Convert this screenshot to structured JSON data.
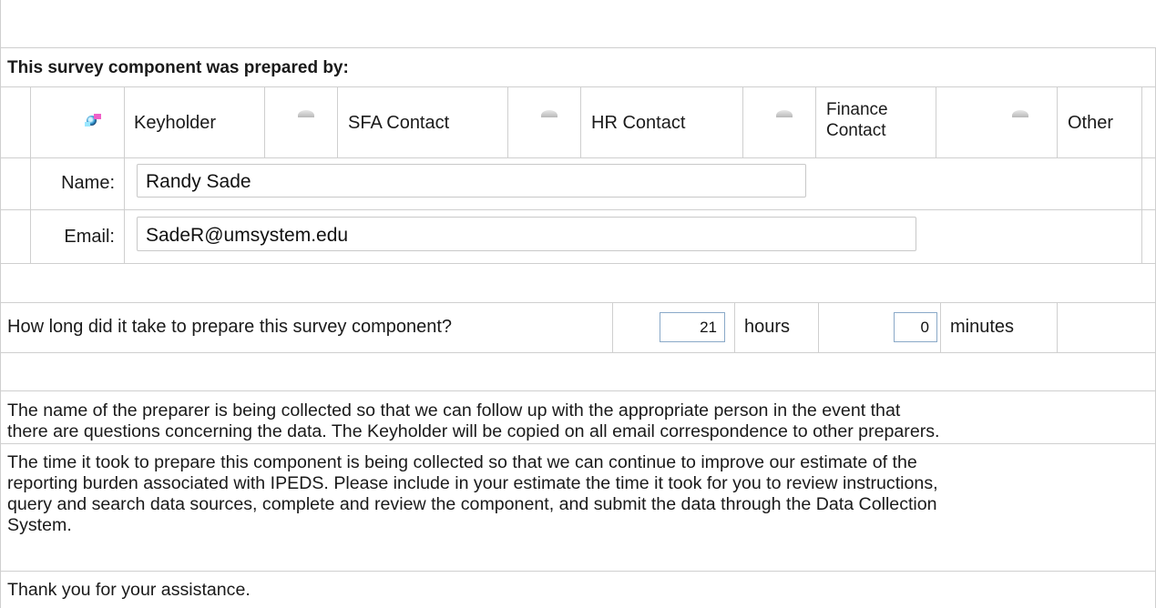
{
  "section": {
    "heading": "This survey component was prepared by:"
  },
  "preparer_options": [
    {
      "label": "Keyholder",
      "selected": true
    },
    {
      "label": "SFA Contact",
      "selected": false
    },
    {
      "label": "HR Contact",
      "selected": false
    },
    {
      "label": "Finance Contact",
      "line1": "Finance",
      "line2": "Contact",
      "selected": false
    },
    {
      "label": "Other",
      "selected": false
    }
  ],
  "name_field": {
    "label": "Name:",
    "value": "Randy Sade"
  },
  "email_field": {
    "label": "Email:",
    "value": "SadeR@umsystem.edu"
  },
  "time": {
    "question": "How long did it take to prepare this survey component?",
    "hours_value": "21",
    "hours_label": "hours",
    "minutes_value": "0",
    "minutes_label": "minutes"
  },
  "notes": {
    "preparer_note_1": "The name of the preparer is being collected so that we can follow up with the appropriate person in the event that",
    "preparer_note_2": "there are questions concerning the data. The Keyholder will be copied on all email correspondence to other preparers.",
    "time_note_1": "The time it took to prepare this component is being collected so that we can continue to improve our estimate of the",
    "time_note_2": "reporting burden associated with IPEDS. Please include in your estimate the time it took for you to review instructions,",
    "time_note_3": "query and search data sources, complete and review the component, and submit the data through the Data Collection",
    "time_note_4": "System.",
    "thanks": "Thank you for your assistance."
  }
}
